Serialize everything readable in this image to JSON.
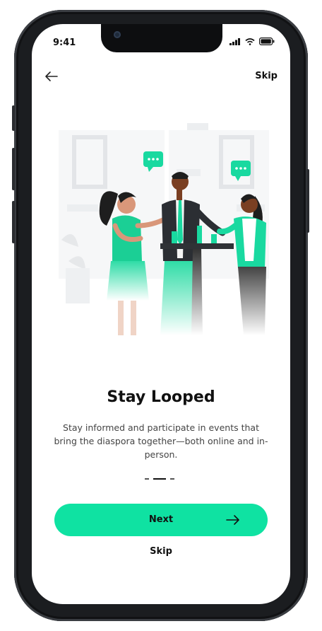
{
  "status_bar": {
    "time": "9:41"
  },
  "header": {
    "skip_label": "Skip"
  },
  "onboarding": {
    "title": "Stay Looped",
    "description": "Stay informed and participate in events that bring the diaspora together—both online and in-person.",
    "page_count": 3,
    "active_page": 2
  },
  "actions": {
    "next_label": "Next",
    "skip_label": "Skip"
  },
  "colors": {
    "accent": "#0fe2a2",
    "text": "#111111",
    "muted": "#444444"
  },
  "icons": {
    "back": "arrow-left-icon",
    "next": "arrow-right-icon",
    "signal": "cellular-signal-icon",
    "wifi": "wifi-icon",
    "battery": "battery-icon"
  }
}
